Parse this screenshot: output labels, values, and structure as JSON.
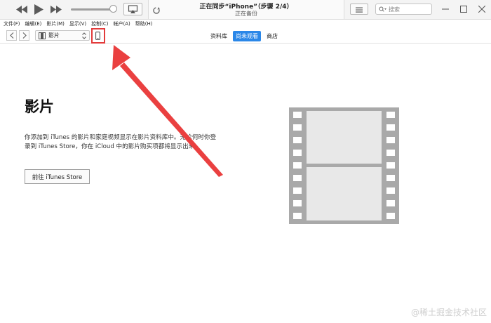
{
  "window": {
    "lcd_title": "正在同步“iPhone”（步骤 2/4）",
    "lcd_subtitle": "正在备份",
    "volume_level": 0.9
  },
  "search": {
    "placeholder": "搜索"
  },
  "menu": {
    "items": [
      "文件(F)",
      "编辑(E)",
      "影片(M)",
      "显示(V)",
      "控制(C)",
      "帐户(A)",
      "帮助(H)"
    ]
  },
  "toolbar": {
    "media_selector": "影片",
    "tabs": [
      {
        "label": "资料库",
        "active": false
      },
      {
        "label": "尚未观看",
        "active": true
      },
      {
        "label": "商店",
        "active": false
      }
    ]
  },
  "main": {
    "title": "影片",
    "description_lines": [
      "你添加到 iTunes 的影片和家庭视频显示在影片资料库中。无论何时你登",
      "录到 iTunes Store，你在 iCloud 中的影片购买项都将显示出来。"
    ],
    "store_button": "前往 iTunes Store"
  },
  "watermark": "@稀土掘金技术社区",
  "colors": {
    "accent": "#2a87e8",
    "annotation": "#e23b3b",
    "film": "#a9a9a9"
  },
  "icons": {
    "rewind": "rewind-icon",
    "play": "play-icon",
    "fast_forward": "fast-forward-icon",
    "airplay": "airplay-icon",
    "sync": "sync-icon",
    "list": "list-icon",
    "search": "search-icon",
    "device": "iphone-icon",
    "film": "film-strip-icon"
  }
}
